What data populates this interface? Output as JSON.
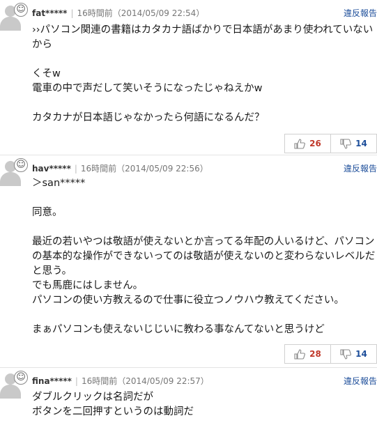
{
  "comments": [
    {
      "user": "fat*****",
      "time": "16時間前（2014/05/09 22:54）",
      "report": "違反報告",
      "text": "››パソコン関連の書籍はカタカナ語ばかりで日本語があまり使われていないから\n\nくそw\n電車の中で声だして笑いそうになったじゃねえかw\n\nカタカナが日本語じゃなかったら何語になるんだ？",
      "good": "26",
      "bad": "14"
    },
    {
      "user": "hav*****",
      "time": "16時間前（2014/05/09 22:56）",
      "report": "違反報告",
      "text": "＞san*****\n\n同意。\n\n最近の若いやつは敬語が使えないとか言ってる年配の人いるけど、パソコンの基本的な操作ができないってのは敬語が使えないのと変わらないレベルだと思う。\nでも馬鹿にはしません。\nパソコンの使い方教えるので仕事に役立つノウハウ教えてください。\n\nまぁパソコンも使えないじじいに教わる事なんてないと思うけど",
      "good": "28",
      "bad": "14"
    },
    {
      "user": "fina*****",
      "time": "16時間前（2014/05/09 22:57）",
      "report": "違反報告",
      "text": "ダブルクリックは名詞だが\nボタンを二回押すというのは動詞だ"
    }
  ],
  "icons": {
    "avatar": "smiley-avatar-icon",
    "good": "thumbs-up-icon",
    "bad": "thumbs-down-icon"
  },
  "colors": {
    "report_link": "#1d4e9a",
    "good_count": "#c0392b",
    "bad_count": "#1d4e9a"
  }
}
